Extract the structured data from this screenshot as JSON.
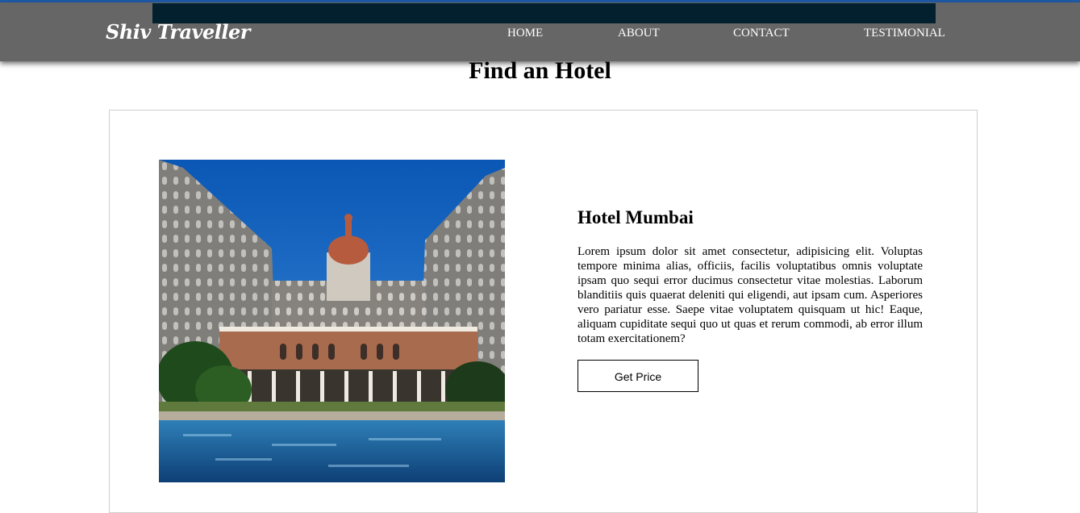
{
  "navbar": {
    "brand": "Shiv Traveller",
    "links": [
      "HOME",
      "ABOUT",
      "CONTACT",
      "TESTIMONIAL"
    ]
  },
  "page": {
    "title": "Find an Hotel"
  },
  "hotel": {
    "name": "Hotel Mumbai",
    "description": "Lorem ipsum dolor sit amet consectetur, adipisicing elit. Voluptas tempore minima alias, officiis, facilis voluptatibus omnis voluptate ipsam quo sequi error ducimus consectetur vitae molestias. Laborum blanditiis quis quaerat deleniti qui eligendi, aut ipsam cum. Asperiores vero pariatur esse. Saepe vitae voluptatem quisquam ut hic! Eaque, aliquam cupiditate sequi quo ut quas et rerum commodi, ab error illum totam exercitationem?",
    "button_label": "Get Price",
    "image_alt": "Hotel Mumbai palace courtyard with pool"
  },
  "colors": {
    "navbar_bg": "#666666",
    "nav_strip": "#02202d",
    "top_line": "#1f5aa8"
  }
}
